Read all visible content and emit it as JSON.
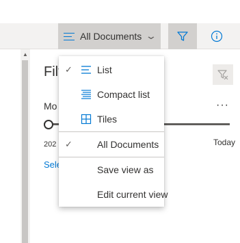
{
  "toolbar": {
    "view_selector_label": "All Documents",
    "filter_icon": "filter-icon",
    "info_icon": "info-icon"
  },
  "filters_pane": {
    "title": "Filt",
    "modified_label": "Mo",
    "more_label": "···",
    "slider_start_label": "202",
    "slider_end_label": "Today",
    "select_link": "Sele"
  },
  "view_menu": {
    "items": [
      {
        "label": "List",
        "icon": "list-icon",
        "checked": true
      },
      {
        "label": "Compact list",
        "icon": "compact-list-icon",
        "checked": false
      },
      {
        "label": "Tiles",
        "icon": "tiles-icon",
        "checked": false
      },
      {
        "label": "All Documents",
        "icon": "",
        "checked": true
      },
      {
        "label": "Save view as",
        "icon": "",
        "checked": false
      },
      {
        "label": "Edit current view",
        "icon": "",
        "checked": false
      }
    ],
    "check_mark": "✓"
  },
  "colors": {
    "accent": "#0078d4",
    "toolbar_bg": "#f3f2f1",
    "selected_bg": "#d2d0ce"
  }
}
